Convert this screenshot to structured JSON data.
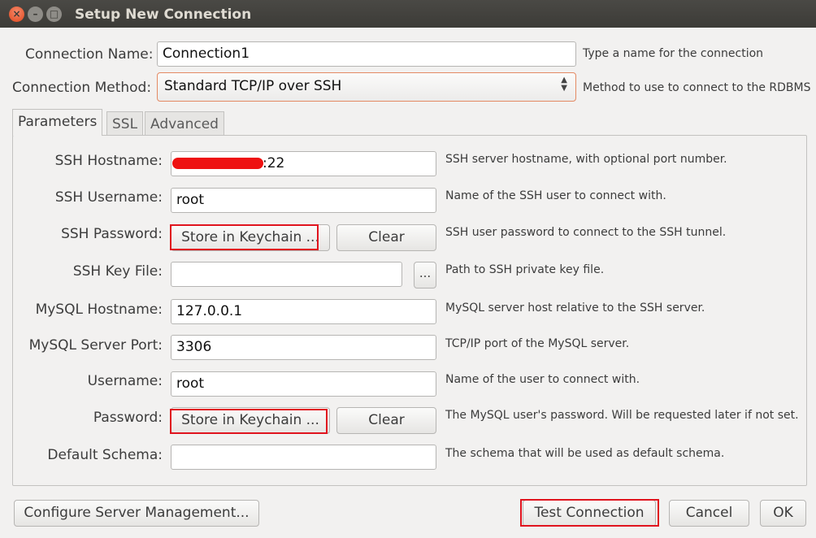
{
  "window": {
    "title": "Setup New Connection",
    "close_glyph": "×",
    "min_glyph": "–",
    "max_glyph": "□"
  },
  "top": {
    "connection_name": {
      "label": "Connection Name:",
      "value": "Connection1",
      "hint": "Type a name for the connection"
    },
    "connection_method": {
      "label": "Connection Method:",
      "value": "Standard TCP/IP over SSH",
      "hint": "Method to use to connect to the RDBMS"
    }
  },
  "tabs": [
    {
      "label": "Parameters",
      "active": true
    },
    {
      "label": "SSL",
      "active": false
    },
    {
      "label": "Advanced",
      "active": false
    }
  ],
  "params": {
    "ssh_hostname": {
      "label": "SSH Hostname:",
      "value": ":22",
      "hint": "SSH server hostname, with optional port number."
    },
    "ssh_username": {
      "label": "SSH Username:",
      "value": "root",
      "hint": "Name of the SSH user to connect with."
    },
    "ssh_password": {
      "label": "SSH Password:",
      "store_label": "Store in Keychain ...",
      "clear_label": "Clear",
      "hint": "SSH user password to connect to the SSH tunnel."
    },
    "ssh_key_file": {
      "label": "SSH Key File:",
      "value": "",
      "browse_label": "...",
      "hint": "Path to SSH private key file."
    },
    "mysql_hostname": {
      "label": "MySQL Hostname:",
      "value": "127.0.0.1",
      "hint": "MySQL server host relative to the SSH server."
    },
    "mysql_port": {
      "label": "MySQL Server Port:",
      "value": "3306",
      "hint": "TCP/IP port of the MySQL server."
    },
    "username": {
      "label": "Username:",
      "value": "root",
      "hint": "Name of the user to connect with."
    },
    "password": {
      "label": "Password:",
      "store_label": "Store in Keychain ...",
      "clear_label": "Clear",
      "hint": "The MySQL user's password. Will be requested later if not set."
    },
    "default_schema": {
      "label": "Default Schema:",
      "value": "",
      "hint": "The schema that will be used as default schema."
    }
  },
  "footer": {
    "configure_label": "Configure Server Management...",
    "test_label": "Test Connection",
    "cancel_label": "Cancel",
    "ok_label": "OK"
  },
  "colors": {
    "highlight": "#e0141e",
    "titlebar": "#3c3b37",
    "select_focus": "#e48a63"
  }
}
